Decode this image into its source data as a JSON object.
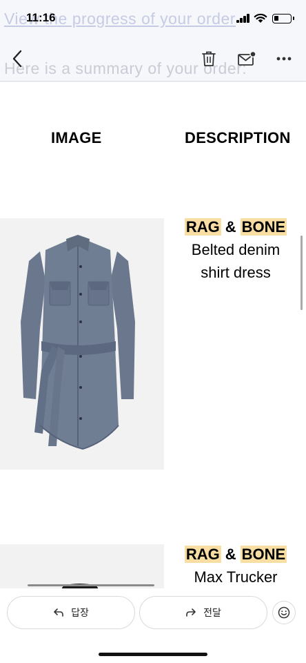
{
  "status_bar": {
    "time": "11:16",
    "battery_percent": 30
  },
  "background_email": {
    "line1": "View the progress of your order",
    "line2": "Here is a summary of your order:"
  },
  "toolbar": {
    "back_icon": "chevron-left-icon",
    "delete_icon": "trash-icon",
    "mail_icon": "mail-unread-icon",
    "more_icon": "more-horizontal-icon"
  },
  "table": {
    "headers": {
      "image": "IMAGE",
      "description": "DESCRIPTION"
    },
    "items": [
      {
        "brand_part1": "RAG",
        "brand_amp": "&",
        "brand_part2": "BONE",
        "name_line1": "Belted denim",
        "name_line2": "shirt dress"
      },
      {
        "brand_part1": "RAG",
        "brand_amp": "&",
        "brand_part2": "BONE",
        "name_line1": "Max Trucker",
        "name_line2": ""
      }
    ]
  },
  "actions": {
    "reply_label": "답장",
    "forward_label": "전달",
    "emoji_icon": "smiley-icon"
  },
  "colors": {
    "brand_highlight": "#f8dea3",
    "denim": "#6f7d92"
  }
}
